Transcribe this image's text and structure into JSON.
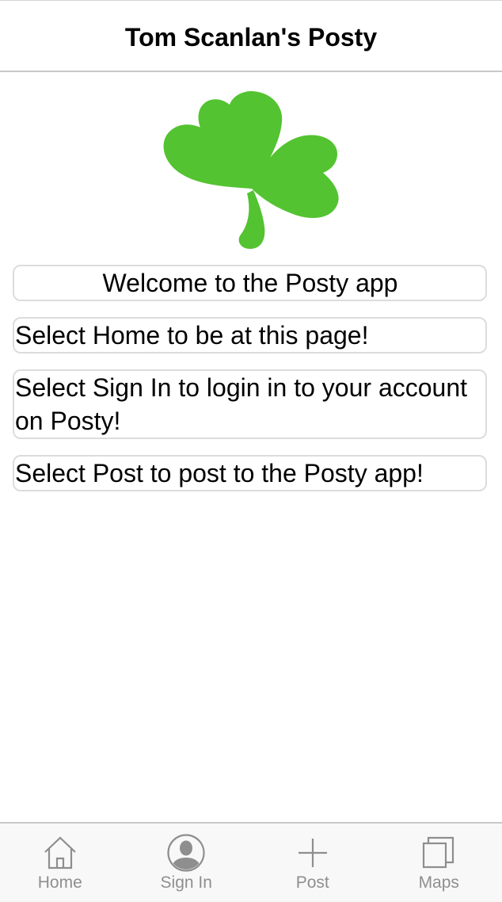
{
  "header": {
    "title": "Tom Scanlan's Posty"
  },
  "logo": {
    "icon": "shamrock-icon",
    "color": "#53c331"
  },
  "cards": [
    {
      "text": "Welcome to the Posty app"
    },
    {
      "text": "Select Home to be at this page!"
    },
    {
      "text": "Select Sign In to login in to your account on Posty!"
    },
    {
      "text": "Select Post to post to the Posty app!"
    }
  ],
  "tabbar": {
    "items": [
      {
        "label": "Home",
        "icon": "home-icon"
      },
      {
        "label": "Sign In",
        "icon": "person-icon"
      },
      {
        "label": "Post",
        "icon": "plus-icon"
      },
      {
        "label": "Maps",
        "icon": "maps-icon"
      }
    ],
    "icon_color": "#8e8e8e"
  }
}
